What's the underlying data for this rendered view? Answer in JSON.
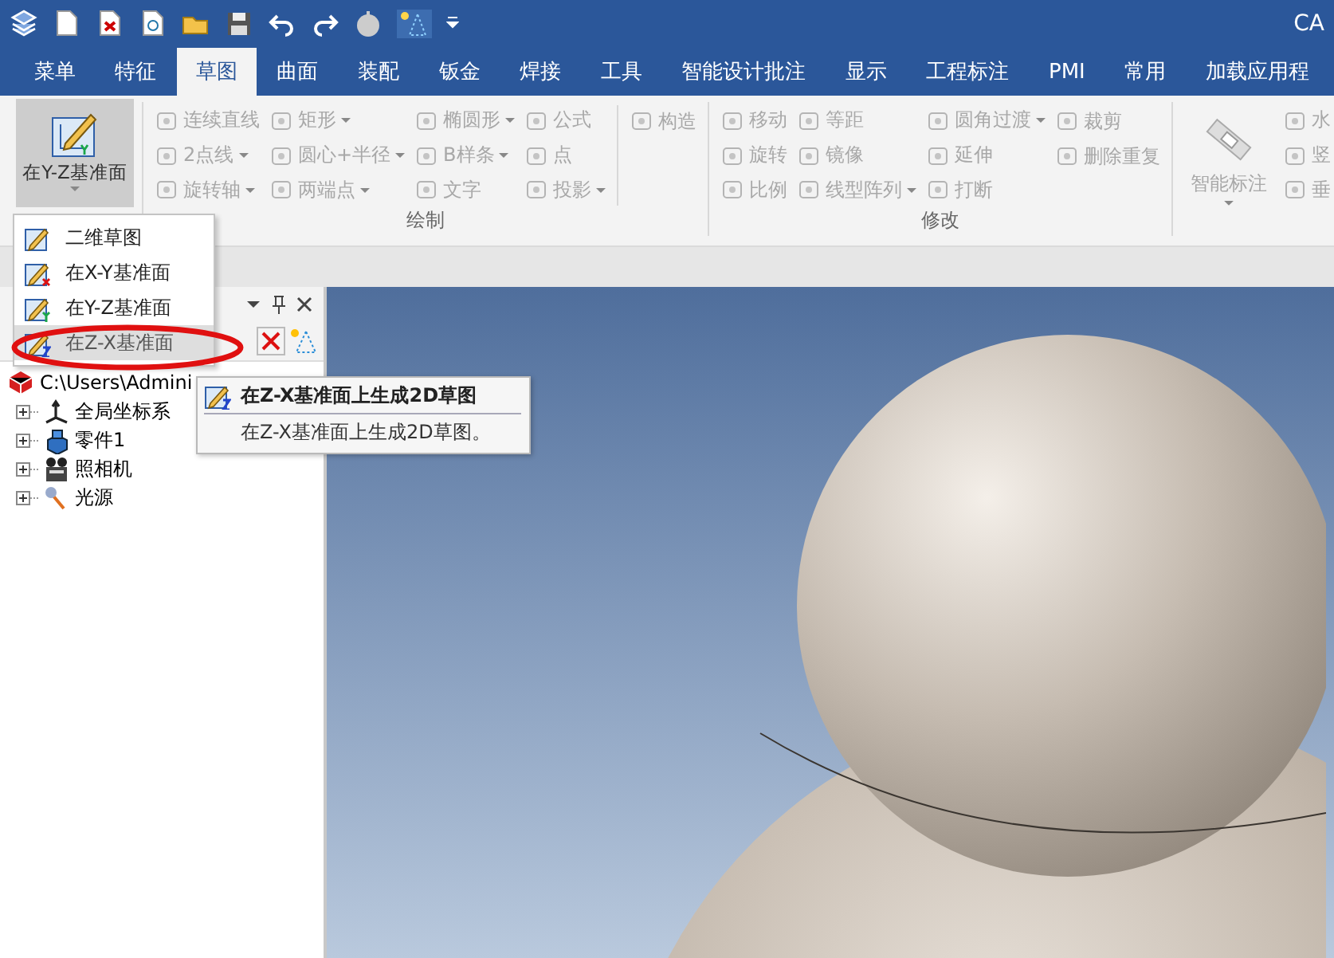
{
  "window": {
    "title": "CA"
  },
  "tabs": [
    {
      "label": "菜单",
      "selected": false
    },
    {
      "label": "特征",
      "selected": false
    },
    {
      "label": "草图",
      "selected": true
    },
    {
      "label": "曲面",
      "selected": false
    },
    {
      "label": "装配",
      "selected": false
    },
    {
      "label": "钣金",
      "selected": false
    },
    {
      "label": "焊接",
      "selected": false
    },
    {
      "label": "工具",
      "selected": false
    },
    {
      "label": "智能设计批注",
      "selected": false
    },
    {
      "label": "显示",
      "selected": false
    },
    {
      "label": "工程标注",
      "selected": false
    },
    {
      "label": "PMI",
      "selected": false
    },
    {
      "label": "常用",
      "selected": false
    },
    {
      "label": "加载应用程",
      "selected": false
    }
  ],
  "ribbon": {
    "sketch_button": {
      "label": "在Y-Z基准面",
      "expanded": true
    },
    "groups": [
      {
        "label": "绘制",
        "columns": [
          {
            "separator_before": false,
            "items": [
              {
                "label": "连续直线",
                "dropdown": false,
                "disabled": true
              },
              {
                "label": "2点线",
                "dropdown": true,
                "disabled": true
              },
              {
                "label": "旋转轴",
                "dropdown": true,
                "disabled": true
              }
            ]
          },
          {
            "separator_before": false,
            "items": [
              {
                "label": "矩形",
                "dropdown": true,
                "disabled": true
              },
              {
                "label": "圆心+半径",
                "dropdown": true,
                "disabled": true
              },
              {
                "label": "两端点",
                "dropdown": true,
                "disabled": true
              }
            ]
          },
          {
            "separator_before": false,
            "items": [
              {
                "label": "椭圆形",
                "dropdown": true,
                "disabled": true
              },
              {
                "label": "B样条",
                "dropdown": true,
                "disabled": true
              },
              {
                "label": "文字",
                "dropdown": false,
                "disabled": true
              }
            ]
          },
          {
            "separator_before": false,
            "items": [
              {
                "label": "公式",
                "dropdown": false,
                "disabled": true
              },
              {
                "label": "点",
                "dropdown": false,
                "disabled": true
              },
              {
                "label": "投影",
                "dropdown": true,
                "disabled": true
              }
            ]
          },
          {
            "separator_before": true,
            "items": [
              {
                "label": "构造",
                "dropdown": false,
                "disabled": true
              }
            ]
          }
        ]
      },
      {
        "label": "修改",
        "columns": [
          {
            "separator_before": false,
            "items": [
              {
                "label": "移动",
                "dropdown": false,
                "disabled": true
              },
              {
                "label": "旋转",
                "dropdown": false,
                "disabled": true
              },
              {
                "label": "比例",
                "dropdown": false,
                "disabled": true
              }
            ]
          },
          {
            "separator_before": false,
            "items": [
              {
                "label": "等距",
                "dropdown": false,
                "disabled": true
              },
              {
                "label": "镜像",
                "dropdown": false,
                "disabled": true
              },
              {
                "label": "线型阵列",
                "dropdown": true,
                "disabled": true
              }
            ]
          },
          {
            "separator_before": false,
            "items": [
              {
                "label": "圆角过渡",
                "dropdown": true,
                "disabled": true
              },
              {
                "label": "延伸",
                "dropdown": false,
                "disabled": true
              },
              {
                "label": "打断",
                "dropdown": false,
                "disabled": true
              }
            ]
          },
          {
            "separator_before": false,
            "items": [
              {
                "label": "裁剪",
                "dropdown": false,
                "disabled": true
              },
              {
                "label": "删除重复",
                "dropdown": false,
                "disabled": true
              }
            ]
          }
        ]
      },
      {
        "large": {
          "label": "智能标注",
          "dropdown": true,
          "disabled": true
        },
        "columns": [
          {
            "separator_before": false,
            "items": [
              {
                "label": "水",
                "dropdown": false,
                "disabled": true
              },
              {
                "label": "竖",
                "dropdown": false,
                "disabled": true
              },
              {
                "label": "垂",
                "dropdown": false,
                "disabled": true
              }
            ]
          }
        ]
      }
    ]
  },
  "dropdown_menu": {
    "items": [
      {
        "label": "二维草图",
        "selected": false
      },
      {
        "label": "在X-Y基准面",
        "selected": false
      },
      {
        "label": "在Y-Z基准面",
        "selected": false
      },
      {
        "label": "在Z-X基准面",
        "selected": true
      }
    ]
  },
  "tooltip": {
    "title": "在Z-X基准面上生成2D草图",
    "description": "在Z-X基准面上生成2D草图。"
  },
  "tree": {
    "root": {
      "label": "C:\\Users\\Admini",
      "children": [
        {
          "label": "全局坐标系",
          "expanded": false
        },
        {
          "label": "零件1",
          "expanded": false
        },
        {
          "label": "照相机",
          "expanded": false
        },
        {
          "label": "光源",
          "expanded": false
        }
      ]
    }
  }
}
